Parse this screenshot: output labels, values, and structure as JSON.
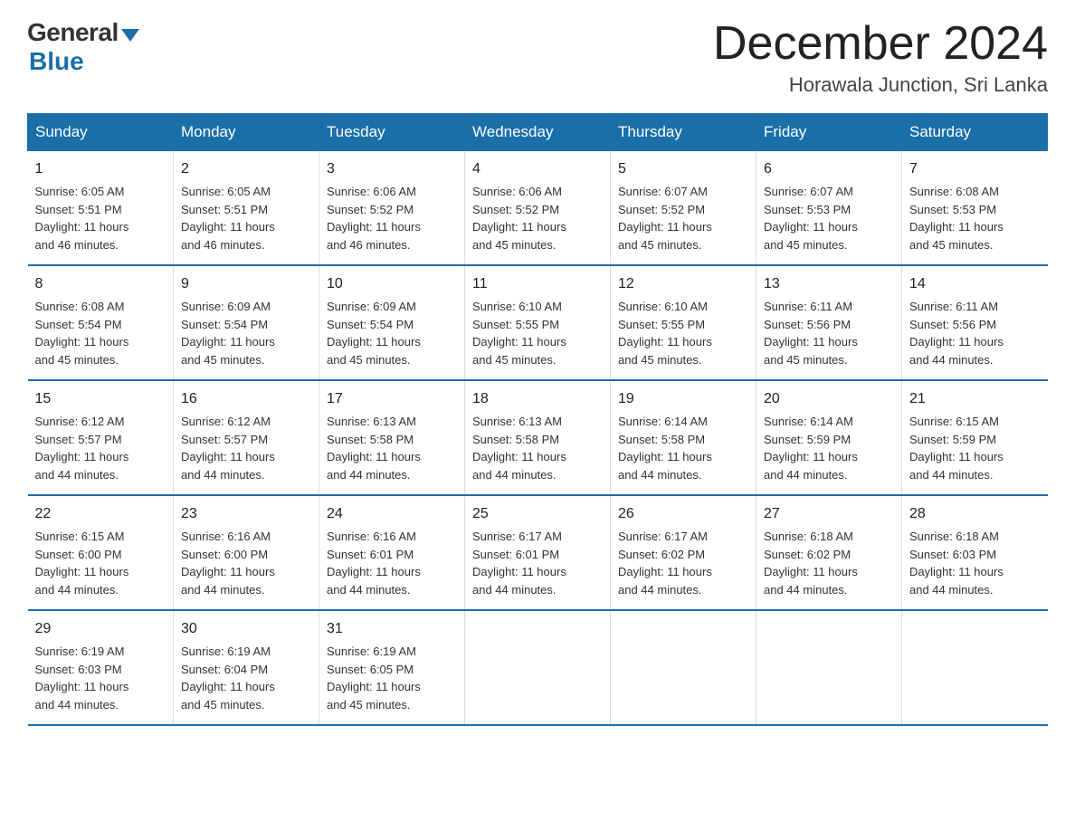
{
  "logo": {
    "general": "General",
    "blue": "Blue"
  },
  "title": "December 2024",
  "location": "Horawala Junction, Sri Lanka",
  "days_header": [
    "Sunday",
    "Monday",
    "Tuesday",
    "Wednesday",
    "Thursday",
    "Friday",
    "Saturday"
  ],
  "weeks": [
    [
      {
        "day": "1",
        "sunrise": "6:05 AM",
        "sunset": "5:51 PM",
        "daylight": "11 hours and 46 minutes."
      },
      {
        "day": "2",
        "sunrise": "6:05 AM",
        "sunset": "5:51 PM",
        "daylight": "11 hours and 46 minutes."
      },
      {
        "day": "3",
        "sunrise": "6:06 AM",
        "sunset": "5:52 PM",
        "daylight": "11 hours and 46 minutes."
      },
      {
        "day": "4",
        "sunrise": "6:06 AM",
        "sunset": "5:52 PM",
        "daylight": "11 hours and 45 minutes."
      },
      {
        "day": "5",
        "sunrise": "6:07 AM",
        "sunset": "5:52 PM",
        "daylight": "11 hours and 45 minutes."
      },
      {
        "day": "6",
        "sunrise": "6:07 AM",
        "sunset": "5:53 PM",
        "daylight": "11 hours and 45 minutes."
      },
      {
        "day": "7",
        "sunrise": "6:08 AM",
        "sunset": "5:53 PM",
        "daylight": "11 hours and 45 minutes."
      }
    ],
    [
      {
        "day": "8",
        "sunrise": "6:08 AM",
        "sunset": "5:54 PM",
        "daylight": "11 hours and 45 minutes."
      },
      {
        "day": "9",
        "sunrise": "6:09 AM",
        "sunset": "5:54 PM",
        "daylight": "11 hours and 45 minutes."
      },
      {
        "day": "10",
        "sunrise": "6:09 AM",
        "sunset": "5:54 PM",
        "daylight": "11 hours and 45 minutes."
      },
      {
        "day": "11",
        "sunrise": "6:10 AM",
        "sunset": "5:55 PM",
        "daylight": "11 hours and 45 minutes."
      },
      {
        "day": "12",
        "sunrise": "6:10 AM",
        "sunset": "5:55 PM",
        "daylight": "11 hours and 45 minutes."
      },
      {
        "day": "13",
        "sunrise": "6:11 AM",
        "sunset": "5:56 PM",
        "daylight": "11 hours and 45 minutes."
      },
      {
        "day": "14",
        "sunrise": "6:11 AM",
        "sunset": "5:56 PM",
        "daylight": "11 hours and 44 minutes."
      }
    ],
    [
      {
        "day": "15",
        "sunrise": "6:12 AM",
        "sunset": "5:57 PM",
        "daylight": "11 hours and 44 minutes."
      },
      {
        "day": "16",
        "sunrise": "6:12 AM",
        "sunset": "5:57 PM",
        "daylight": "11 hours and 44 minutes."
      },
      {
        "day": "17",
        "sunrise": "6:13 AM",
        "sunset": "5:58 PM",
        "daylight": "11 hours and 44 minutes."
      },
      {
        "day": "18",
        "sunrise": "6:13 AM",
        "sunset": "5:58 PM",
        "daylight": "11 hours and 44 minutes."
      },
      {
        "day": "19",
        "sunrise": "6:14 AM",
        "sunset": "5:58 PM",
        "daylight": "11 hours and 44 minutes."
      },
      {
        "day": "20",
        "sunrise": "6:14 AM",
        "sunset": "5:59 PM",
        "daylight": "11 hours and 44 minutes."
      },
      {
        "day": "21",
        "sunrise": "6:15 AM",
        "sunset": "5:59 PM",
        "daylight": "11 hours and 44 minutes."
      }
    ],
    [
      {
        "day": "22",
        "sunrise": "6:15 AM",
        "sunset": "6:00 PM",
        "daylight": "11 hours and 44 minutes."
      },
      {
        "day": "23",
        "sunrise": "6:16 AM",
        "sunset": "6:00 PM",
        "daylight": "11 hours and 44 minutes."
      },
      {
        "day": "24",
        "sunrise": "6:16 AM",
        "sunset": "6:01 PM",
        "daylight": "11 hours and 44 minutes."
      },
      {
        "day": "25",
        "sunrise": "6:17 AM",
        "sunset": "6:01 PM",
        "daylight": "11 hours and 44 minutes."
      },
      {
        "day": "26",
        "sunrise": "6:17 AM",
        "sunset": "6:02 PM",
        "daylight": "11 hours and 44 minutes."
      },
      {
        "day": "27",
        "sunrise": "6:18 AM",
        "sunset": "6:02 PM",
        "daylight": "11 hours and 44 minutes."
      },
      {
        "day": "28",
        "sunrise": "6:18 AM",
        "sunset": "6:03 PM",
        "daylight": "11 hours and 44 minutes."
      }
    ],
    [
      {
        "day": "29",
        "sunrise": "6:19 AM",
        "sunset": "6:03 PM",
        "daylight": "11 hours and 44 minutes."
      },
      {
        "day": "30",
        "sunrise": "6:19 AM",
        "sunset": "6:04 PM",
        "daylight": "11 hours and 45 minutes."
      },
      {
        "day": "31",
        "sunrise": "6:19 AM",
        "sunset": "6:05 PM",
        "daylight": "11 hours and 45 minutes."
      },
      {
        "day": "",
        "sunrise": "",
        "sunset": "",
        "daylight": ""
      },
      {
        "day": "",
        "sunrise": "",
        "sunset": "",
        "daylight": ""
      },
      {
        "day": "",
        "sunrise": "",
        "sunset": "",
        "daylight": ""
      },
      {
        "day": "",
        "sunrise": "",
        "sunset": "",
        "daylight": ""
      }
    ]
  ],
  "labels": {
    "sunrise": "Sunrise:",
    "sunset": "Sunset:",
    "daylight": "Daylight:"
  }
}
